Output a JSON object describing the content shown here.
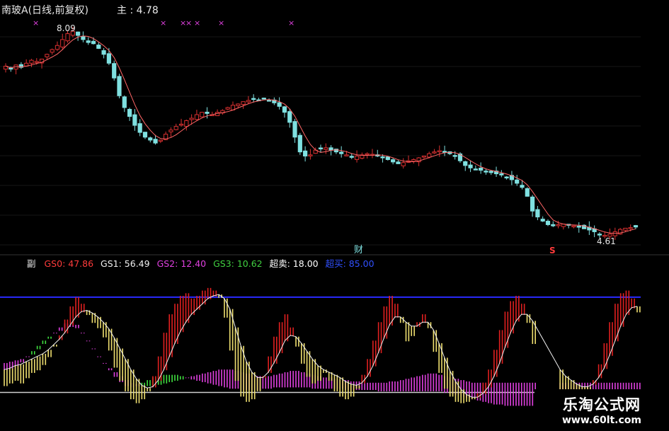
{
  "main_panel": {
    "title": "南玻A(日线,前复权)",
    "indicator_label": "主 : 4.78",
    "high_label": "8.09",
    "low_label": "4.61",
    "event_label": "财",
    "signal_label": "S",
    "mark_symbol": "×",
    "mark_count": 7
  },
  "sub_panel": {
    "title": "副",
    "indicators": [
      {
        "label": "GS0: 47.86",
        "color": "#ff3b3b"
      },
      {
        "label": "GS1: 56.49",
        "color": "#f0f0f0"
      },
      {
        "label": "GS2: 12.40",
        "color": "#e040e0"
      },
      {
        "label": "GS3: 10.62",
        "color": "#40d040"
      },
      {
        "label": "超卖: 18.00",
        "color": "#ffffff"
      },
      {
        "label": "超买: 85.00",
        "color": "#3050ff"
      }
    ]
  },
  "watermark": {
    "name": "乐淘公式网",
    "url": "www.60lt.com"
  },
  "colors": {
    "bull": "#d83030",
    "bear": "#7fe0e0",
    "ma": "#ff6666",
    "mark": "#e040e0",
    "red_osc": "#e02020",
    "yellow_osc": "#f0e070",
    "green_band": "#40e040",
    "magenta_band": "#e040e0",
    "overbought": "#2a2aff",
    "oversold": "#d0d0d0"
  },
  "chart_data": [
    {
      "type": "candlestick",
      "title": "南玻A(日线,前复权)",
      "price_annotations": {
        "high": 8.09,
        "low": 4.61,
        "last": 4.78
      },
      "close": [
        7.5,
        7.45,
        7.52,
        7.48,
        7.55,
        7.6,
        7.58,
        7.62,
        7.7,
        7.78,
        7.85,
        7.95,
        8.05,
        8.09,
        8.02,
        7.95,
        7.9,
        7.88,
        7.8,
        7.7,
        7.55,
        7.3,
        7.0,
        6.8,
        6.65,
        6.5,
        6.38,
        6.3,
        6.25,
        6.2,
        6.25,
        6.35,
        6.42,
        6.48,
        6.52,
        6.58,
        6.62,
        6.68,
        6.72,
        6.7,
        6.68,
        6.72,
        6.75,
        6.8,
        6.84,
        6.86,
        6.9,
        6.92,
        6.95,
        6.93,
        6.95,
        6.92,
        6.88,
        6.82,
        6.72,
        6.55,
        6.3,
        6.05,
        5.98,
        6.0,
        6.08,
        6.1,
        6.12,
        6.08,
        6.05,
        6.02,
        6.0,
        5.96,
        5.98,
        6.0,
        6.02,
        6.01,
        5.98,
        5.96,
        5.92,
        5.88,
        5.85,
        5.87,
        5.9,
        5.92,
        5.95,
        5.98,
        6.02,
        6.05,
        6.07,
        6.06,
        6.02,
        5.98,
        5.9,
        5.82,
        5.78,
        5.76,
        5.74,
        5.72,
        5.7,
        5.68,
        5.66,
        5.62,
        5.58,
        5.52,
        5.45,
        5.3,
        5.05,
        4.95,
        4.88,
        4.82,
        4.8,
        4.82,
        4.83,
        4.82,
        4.8,
        4.78,
        4.75,
        4.73,
        4.7,
        4.66,
        4.64,
        4.66,
        4.7,
        4.74,
        4.76,
        4.77,
        4.78
      ]
    },
    {
      "type": "bar",
      "title": "副",
      "series": [
        {
          "name": "GS0",
          "values": [
            0.18,
            0.2,
            0.22,
            0.2,
            0.24,
            0.28,
            0.3,
            0.34,
            0.4,
            0.48,
            0.56,
            0.68,
            0.78,
            0.85,
            0.8,
            0.72,
            0.66,
            0.62,
            0.55,
            0.45,
            0.32,
            0.22,
            0.14,
            0.08,
            0.05,
            0.08,
            0.14,
            0.25,
            0.4,
            0.58,
            0.72,
            0.8,
            0.86,
            0.88,
            0.84,
            0.86,
            0.9,
            0.92,
            0.9,
            0.85,
            0.7,
            0.45,
            0.22,
            0.1,
            0.06,
            0.08,
            0.14,
            0.25,
            0.4,
            0.55,
            0.66,
            0.72,
            0.62,
            0.48,
            0.35,
            0.25,
            0.2,
            0.22,
            0.28,
            0.22,
            0.14,
            0.1,
            0.08,
            0.1,
            0.16,
            0.26,
            0.38,
            0.52,
            0.66,
            0.78,
            0.86,
            0.8,
            0.66,
            0.52,
            0.56,
            0.66,
            0.72,
            0.62,
            0.44,
            0.28,
            0.16,
            0.1,
            0.06,
            0.05,
            0.06,
            0.08,
            0.12,
            0.2,
            0.3,
            0.45,
            0.6,
            0.74,
            0.82,
            0.86,
            0.8,
            0.66,
            0.5,
            0.36,
            0.25,
            0.18,
            0.14,
            0.12,
            0.1,
            0.09,
            0.08,
            0.1,
            0.14,
            0.22,
            0.34,
            0.5,
            0.66,
            0.8,
            0.88,
            0.9,
            0.84,
            0.74
          ]
        },
        {
          "name": "GS1",
          "values": [
            0.3,
            0.31,
            0.33,
            0.34,
            0.36,
            0.38,
            0.4,
            0.42,
            0.45,
            0.49,
            0.53,
            0.58,
            0.64,
            0.7,
            0.74,
            0.75,
            0.73,
            0.7,
            0.66,
            0.61,
            0.54,
            0.46,
            0.38,
            0.3,
            0.23,
            0.18,
            0.16,
            0.17,
            0.22,
            0.3,
            0.4,
            0.5,
            0.59,
            0.66,
            0.72,
            0.76,
            0.8,
            0.84,
            0.86,
            0.87,
            0.84,
            0.76,
            0.62,
            0.48,
            0.36,
            0.28,
            0.24,
            0.24,
            0.28,
            0.35,
            0.43,
            0.52,
            0.56,
            0.55,
            0.5,
            0.44,
            0.38,
            0.33,
            0.3,
            0.28,
            0.26,
            0.24,
            0.21,
            0.19,
            0.18,
            0.2,
            0.25,
            0.33,
            0.43,
            0.54,
            0.64,
            0.7,
            0.7,
            0.66,
            0.63,
            0.63,
            0.66,
            0.66,
            0.6,
            0.5,
            0.39,
            0.29,
            0.21,
            0.15,
            0.11,
            0.09,
            0.09,
            0.12,
            0.17,
            0.25,
            0.35,
            0.47,
            0.58,
            0.67,
            0.72,
            0.72,
            0.67,
            0.59,
            0.5,
            0.42,
            0.35,
            0.3,
            0.25,
            0.22,
            0.19,
            0.17,
            0.17,
            0.19,
            0.24,
            0.31,
            0.41,
            0.52,
            0.63,
            0.72,
            0.77,
            0.78
          ]
        },
        {
          "name": "GS2",
          "values": [
            0.35,
            0.36,
            0.37,
            0.38,
            0.4,
            0.42,
            0.46,
            0.5,
            0.54,
            0.58,
            0.62,
            0.65,
            0.66,
            0.64,
            0.58,
            0.52,
            0.46,
            0.4,
            0.35,
            0.31,
            0.28,
            0.25,
            0.22,
            0.2,
            0.19,
            0.18,
            0.18,
            0.18,
            0.19,
            0.2,
            0.21,
            0.22,
            0.23,
            0.24,
            0.25,
            0.26,
            0.27,
            0.28,
            0.29,
            0.3,
            0.3,
            0.3,
            0.29,
            0.28,
            0.27,
            0.26,
            0.25,
            0.25,
            0.25,
            0.26,
            0.27,
            0.28,
            0.29,
            0.29,
            0.28,
            0.27,
            0.26,
            0.25,
            0.24,
            0.24,
            0.23,
            0.22,
            0.22,
            0.21,
            0.21,
            0.2,
            0.2,
            0.2,
            0.2,
            0.2,
            0.21,
            0.21,
            0.22,
            0.23,
            0.24,
            0.25,
            0.26,
            0.27,
            0.27,
            0.26,
            0.25,
            0.24,
            0.23,
            0.22,
            0.21,
            0.2,
            0.2,
            0.2,
            0.2,
            0.2,
            0.2,
            0.2,
            0.2,
            0.2,
            0.2,
            0.2,
            0.2,
            0.2,
            0.2,
            0.2,
            0.2,
            0.2,
            0.2,
            0.2,
            0.2,
            0.2,
            0.2,
            0.2,
            0.2,
            0.2,
            0.2,
            0.2,
            0.2,
            0.2,
            0.2,
            0.2
          ]
        },
        {
          "name": "GS3",
          "values": [
            0.3,
            0.31,
            0.33,
            0.36,
            0.4,
            0.44,
            0.48,
            0.52,
            0.55,
            0.58,
            0.6,
            0.62,
            0.63,
            0.62,
            0.58,
            0.52,
            0.46,
            0.4,
            0.35,
            0.3,
            0.25,
            0.21,
            0.18,
            0.17,
            0.18,
            0.2,
            0.22,
            0.24,
            0.25,
            0.26,
            0.26,
            0.26,
            0.25,
            0.24,
            0.23,
            0.22,
            0.21,
            0.2,
            0.19,
            0.18,
            0.17,
            0.16,
            0.16,
            0.15,
            0.15,
            0.15,
            0.15,
            0.16,
            0.16,
            0.17,
            0.17,
            0.17,
            0.17,
            0.17,
            0.17,
            0.17,
            0.16,
            0.16,
            0.16,
            0.16,
            0.16,
            0.16,
            0.15,
            0.15,
            0.15,
            0.15,
            0.15,
            0.15,
            0.14,
            0.14,
            0.14,
            0.14,
            0.14,
            0.14,
            0.14,
            0.14,
            0.14,
            0.14,
            0.14,
            0.14,
            0.13,
            0.12,
            0.11,
            0.1,
            0.09,
            0.08,
            0.07,
            0.06,
            0.05,
            0.04,
            0.04,
            0.03,
            0.03,
            0.03,
            0.03,
            0.03,
            0.03,
            0.03,
            0.03,
            0.03,
            0.03,
            0.03,
            0.03,
            0.03,
            0.03,
            0.03,
            0.03,
            0.03,
            0.03,
            0.03,
            0.03,
            0.03,
            0.03,
            0.03,
            0.03,
            0.03
          ]
        }
      ],
      "thresholds": {
        "oversold": 18.0,
        "overbought": 85.0
      }
    }
  ]
}
